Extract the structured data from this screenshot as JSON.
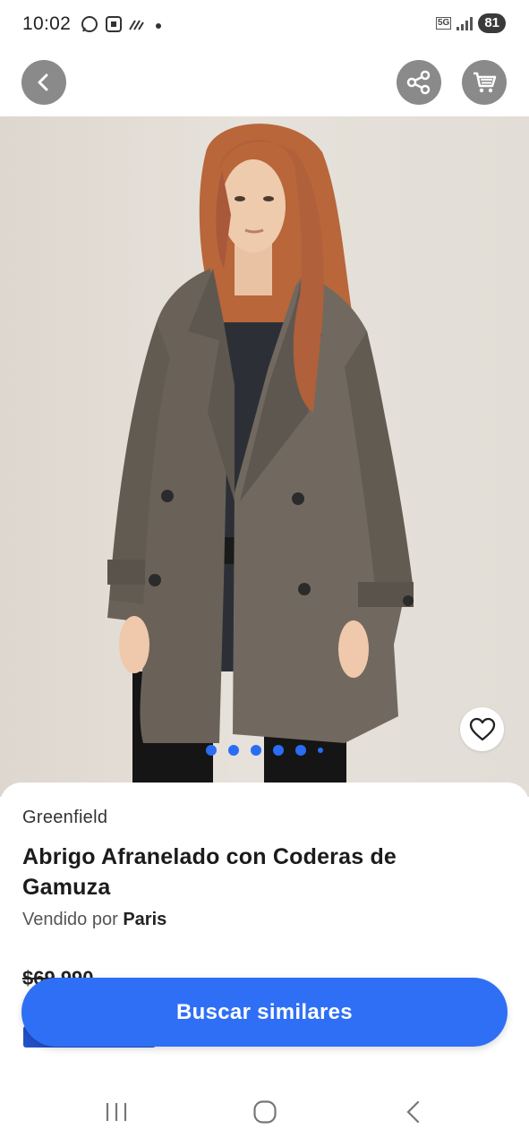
{
  "status_bar": {
    "time": "10:02",
    "network": "5G",
    "battery": "81",
    "icons": [
      "whatsapp-icon",
      "screen-record-icon",
      "nfc-icon",
      "dot-icon",
      "signal-icon",
      "battery-icon"
    ]
  },
  "nav": {
    "back_icon": "chevron-left-icon",
    "share_icon": "share-icon",
    "cart_icon": "cart-icon"
  },
  "gallery": {
    "image_count": 6,
    "active_index": 0,
    "favorite_icon": "heart-outline-icon"
  },
  "product": {
    "brand": "Greenfield",
    "title": "Abrigo Afranelado con Coderas de Gamuza",
    "seller_prefix": "Vendido por",
    "seller_name": "Paris",
    "price_old": "$69.990"
  },
  "cta": {
    "label": "Buscar similares"
  },
  "colors": {
    "accent": "#2f6ff5",
    "badge": "#2451c9",
    "nav_buttons": "#8a8a8a"
  },
  "system_nav": [
    "recents-icon",
    "home-icon",
    "back-icon"
  ]
}
